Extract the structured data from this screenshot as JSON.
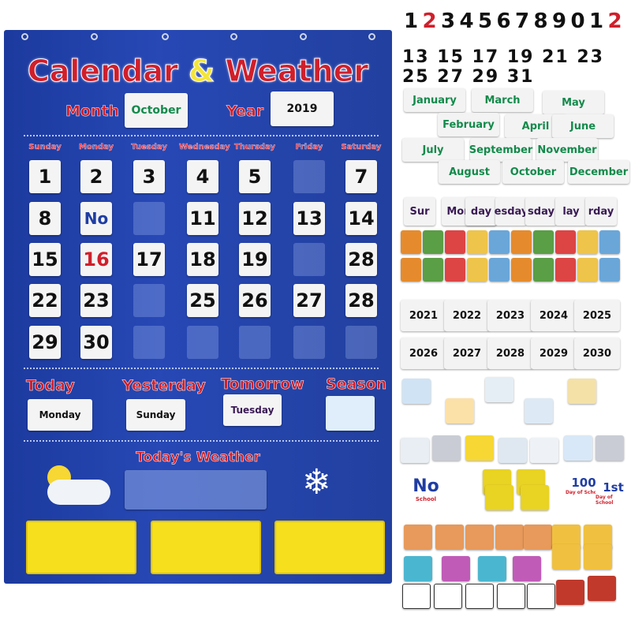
{
  "chart": {
    "title_a": "Calendar",
    "title_amp": "&",
    "title_b": "Weather",
    "month_label": "Month",
    "month_value": "October",
    "year_label": "Year",
    "year_value": "2019",
    "weekdays": [
      "Sunday",
      "Monday",
      "Tuesday",
      "Wednesday",
      "Thursday",
      "Friday",
      "Saturday"
    ],
    "days": [
      [
        "1",
        "2",
        "3",
        "4",
        "5",
        "",
        "7"
      ],
      [
        "8",
        "No",
        "",
        "11",
        "12",
        "13",
        "14"
      ],
      [
        "15",
        "16",
        "17",
        "18",
        "19",
        "",
        "28"
      ],
      [
        "22",
        "23",
        "",
        "25",
        "26",
        "27",
        "28"
      ],
      [
        "29",
        "30",
        "",
        "",
        "",
        "",
        ""
      ]
    ],
    "no_school_sub": "School",
    "today_label": "Today",
    "today_value": "Monday",
    "yesterday_label": "Yesterday",
    "yesterday_value": "Sunday",
    "tomorrow_label": "Tomorrow",
    "tomorrow_value": "Tuesday",
    "season_label": "Season",
    "weather_label": "Today's Weather",
    "red_day": "16",
    "accent_red": "#d01f2b",
    "panel_blue": "#2748b5",
    "pocket_yellow": "#f6df1d"
  },
  "extras": {
    "digits_row1": [
      "1",
      "2",
      "3",
      "4",
      "5",
      "6",
      "7",
      "8",
      "9",
      "0",
      "1",
      "2"
    ],
    "digits_row2": "13 15 17 19 21 23 25 27 29 31",
    "months": [
      "January",
      "March",
      "May",
      "February",
      "April",
      "June",
      "July",
      "September",
      "November",
      "August",
      "October",
      "December"
    ],
    "weekday_cards": [
      "Sur",
      "Monday",
      "day",
      "esday",
      "sday",
      "lay",
      "rday"
    ],
    "years": [
      "2021",
      "2022",
      "2023",
      "2024",
      "2025",
      "2026",
      "2027",
      "2028",
      "2029",
      "2030"
    ],
    "no_school": "No",
    "school": "School",
    "day100": "100",
    "day100_sub": "Day of School",
    "first": "1st",
    "first_sub": "Day of School"
  }
}
